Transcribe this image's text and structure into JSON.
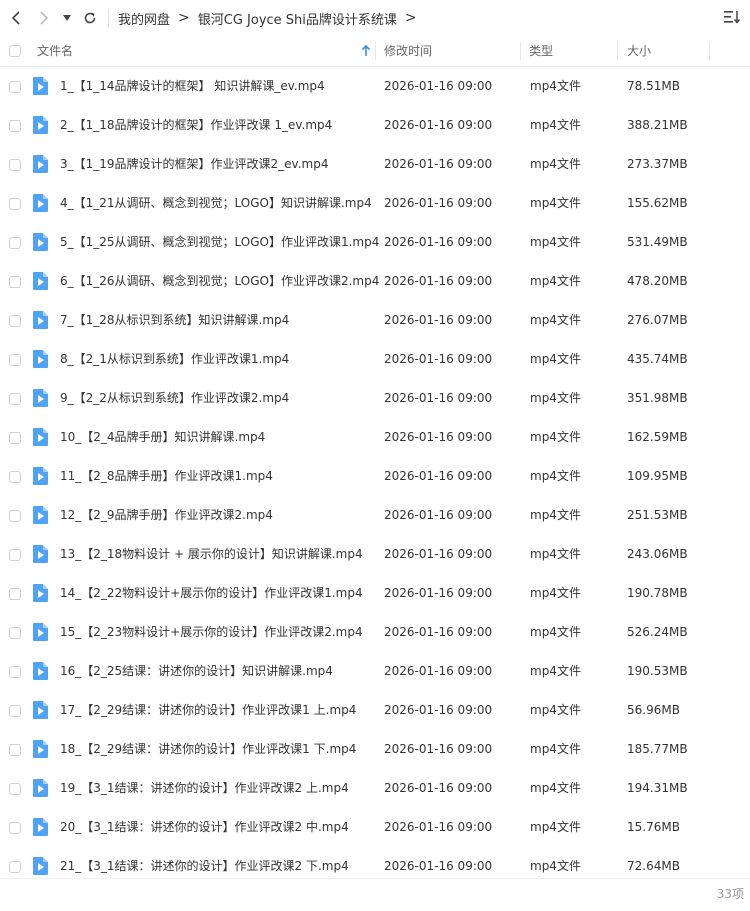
{
  "breadcrumb": {
    "root": "我的网盘",
    "current": "银河CG Joyce Shi品牌设计系统课"
  },
  "columns": {
    "name": "文件名",
    "modified": "修改时间",
    "type": "类型",
    "size": "大小"
  },
  "files": [
    {
      "name": "1_【1_14品牌设计的框架】 知识讲解课_ev.mp4",
      "modified": "2026-01-16 09:00",
      "type": "mp4文件",
      "size": "78.51MB"
    },
    {
      "name": "2_【1_18品牌设计的框架】作业评改课 1_ev.mp4",
      "modified": "2026-01-16 09:00",
      "type": "mp4文件",
      "size": "388.21MB"
    },
    {
      "name": "3_【1_19品牌设计的框架】作业评改课2_ev.mp4",
      "modified": "2026-01-16 09:00",
      "type": "mp4文件",
      "size": "273.37MB"
    },
    {
      "name": "4_【1_21从调研、概念到视觉；LOGO】知识讲解课.mp4",
      "modified": "2026-01-16 09:00",
      "type": "mp4文件",
      "size": "155.62MB"
    },
    {
      "name": "5_【1_25从调研、概念到视觉；LOGO】作业评改课1.mp4",
      "modified": "2026-01-16 09:00",
      "type": "mp4文件",
      "size": "531.49MB"
    },
    {
      "name": "6_【1_26从调研、概念到视觉；LOGO】作业评改课2.mp4",
      "modified": "2026-01-16 09:00",
      "type": "mp4文件",
      "size": "478.20MB"
    },
    {
      "name": "7_【1_28从标识到系统】知识讲解课.mp4",
      "modified": "2026-01-16 09:00",
      "type": "mp4文件",
      "size": "276.07MB"
    },
    {
      "name": "8_【2_1从标识到系统】作业评改课1.mp4",
      "modified": "2026-01-16 09:00",
      "type": "mp4文件",
      "size": "435.74MB"
    },
    {
      "name": "9_【2_2从标识到系统】作业评改课2.mp4",
      "modified": "2026-01-16 09:00",
      "type": "mp4文件",
      "size": "351.98MB"
    },
    {
      "name": "10_【2_4品牌手册】知识讲解课.mp4",
      "modified": "2026-01-16 09:00",
      "type": "mp4文件",
      "size": "162.59MB"
    },
    {
      "name": "11_【2_8品牌手册】作业评改课1.mp4",
      "modified": "2026-01-16 09:00",
      "type": "mp4文件",
      "size": "109.95MB"
    },
    {
      "name": "12_【2_9品牌手册】作业评改课2.mp4",
      "modified": "2026-01-16 09:00",
      "type": "mp4文件",
      "size": "251.53MB"
    },
    {
      "name": "13_【2_18物料设计 + 展示你的设计】知识讲解课.mp4",
      "modified": "2026-01-16 09:00",
      "type": "mp4文件",
      "size": "243.06MB"
    },
    {
      "name": "14_【2_22物料设计+展示你的设计】作业评改课1.mp4",
      "modified": "2026-01-16 09:00",
      "type": "mp4文件",
      "size": "190.78MB"
    },
    {
      "name": "15_【2_23物料设计+展示你的设计】作业评改课2.mp4",
      "modified": "2026-01-16 09:00",
      "type": "mp4文件",
      "size": "526.24MB"
    },
    {
      "name": "16_【2_25结课：讲述你的设计】知识讲解课.mp4",
      "modified": "2026-01-16 09:00",
      "type": "mp4文件",
      "size": "190.53MB"
    },
    {
      "name": "17_【2_29结课：讲述你的设计】作业评改课1 上.mp4",
      "modified": "2026-01-16 09:00",
      "type": "mp4文件",
      "size": "56.96MB"
    },
    {
      "name": "18_【2_29结课：讲述你的设计】作业评改课1 下.mp4",
      "modified": "2026-01-16 09:00",
      "type": "mp4文件",
      "size": "185.77MB"
    },
    {
      "name": "19_【3_1结课：讲述你的设计】作业评改课2 上.mp4",
      "modified": "2026-01-16 09:00",
      "type": "mp4文件",
      "size": "194.31MB"
    },
    {
      "name": "20_【3_1结课：讲述你的设计】作业评改课2 中.mp4",
      "modified": "2026-01-16 09:00",
      "type": "mp4文件",
      "size": "15.76MB"
    },
    {
      "name": "21_【3_1结课：讲述你的设计】作业评改课2 下.mp4",
      "modified": "2026-01-16 09:00",
      "type": "mp4文件",
      "size": "72.64MB"
    }
  ],
  "item_count": "33项",
  "colors": {
    "accent": "#3b8cf0",
    "icon_blue": "#4fa3f7"
  },
  "icons": {
    "back": "chevron-left-icon",
    "forward": "chevron-right-icon",
    "dropdown": "caret-down-icon",
    "refresh": "refresh-icon",
    "sort": "sort-list-icon",
    "sort_direction": "arrow-up-icon",
    "file": "video-file-icon"
  }
}
